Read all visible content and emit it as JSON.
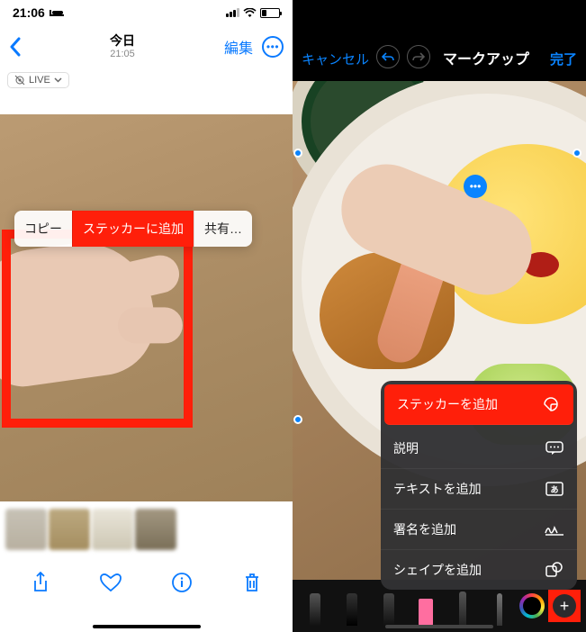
{
  "left": {
    "status": {
      "time": "21:06"
    },
    "header": {
      "title": "今日",
      "subtitle": "21:05",
      "edit": "編集"
    },
    "live_badge": "LIVE",
    "popover": {
      "copy": "コピー",
      "add_sticker": "ステッカーに追加",
      "share": "共有…"
    }
  },
  "right": {
    "header": {
      "cancel": "キャンセル",
      "title": "マークアップ",
      "done": "完了"
    },
    "menu": {
      "add_sticker": "ステッカーを追加",
      "description": "説明",
      "add_text": "テキストを追加",
      "add_signature": "署名を追加",
      "add_shape": "シェイプを追加"
    }
  }
}
